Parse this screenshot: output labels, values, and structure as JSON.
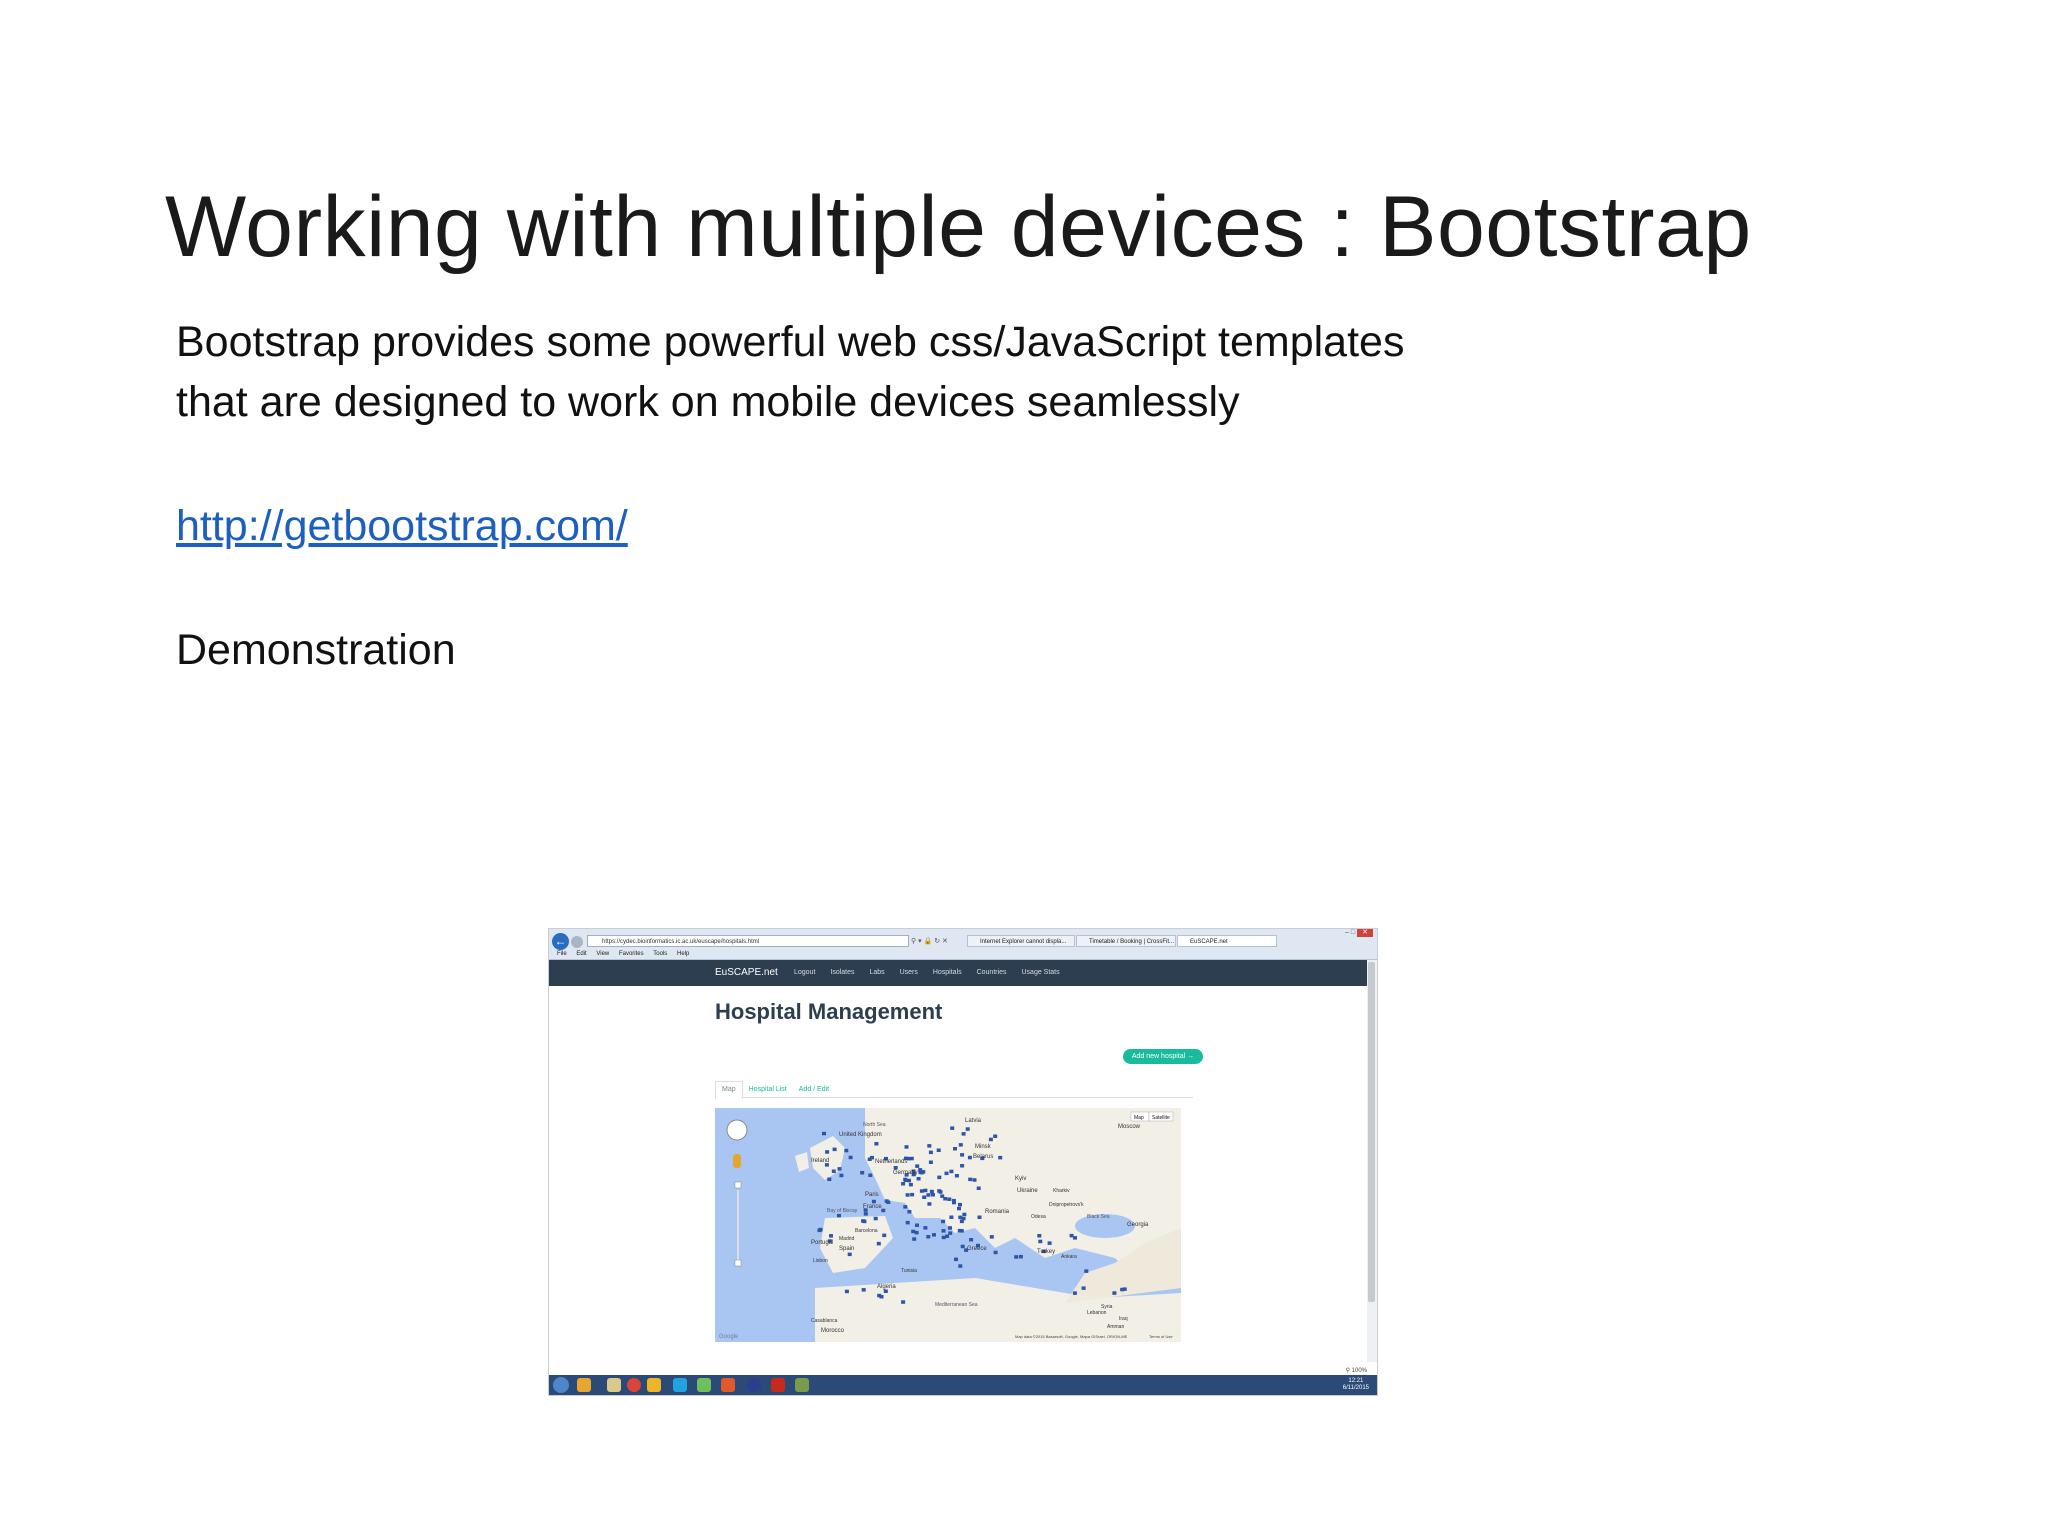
{
  "slide": {
    "title": "Working with multiple devices : Bootstrap",
    "body_line1": "Bootstrap provides some powerful web css/JavaScript templates",
    "body_line2": "that are designed to work on mobile devices seamlessly",
    "link": "http://getbootstrap.com/",
    "demo_label": "Demonstration"
  },
  "browser": {
    "url": "https://cydec.bioinformatics.ic.ac.uk/euscape/hospitals.html",
    "tabs": [
      "Internet Explorer cannot displa...",
      "Timetable / Booking | CrossFit...",
      "EuSCAPE.net"
    ],
    "menu": [
      "File",
      "Edit",
      "View",
      "Favorites",
      "Tools",
      "Help"
    ],
    "zoom": "100%"
  },
  "app": {
    "brand": "EuSCAPE.net",
    "nav": [
      "Logout",
      "Isolates",
      "Labs",
      "Users",
      "Hospitals",
      "Countries",
      "Usage Stats"
    ],
    "heading": "Hospital Management",
    "add_button": "Add new hospital →",
    "tabs": [
      "Map",
      "Hospital List",
      "Add / Edit"
    ]
  },
  "map": {
    "type_buttons": [
      "Map",
      "Satellite"
    ],
    "labels": [
      "Latvia",
      "Moscow",
      "United Kingdom",
      "Ireland",
      "Netherlands",
      "Germany",
      "Belarus",
      "Minsk",
      "Kyiv",
      "Ukraine",
      "Paris",
      "France",
      "Romania",
      "Bay of Biscay",
      "Portugal",
      "Spain",
      "Madrid",
      "Barcelona",
      "Greece",
      "Turkey",
      "Georgia",
      "Black Sea",
      "Algeria",
      "Tunisia",
      "Morocco",
      "Casablanca",
      "Lisbon",
      "Syria",
      "Iraq",
      "Lebanon",
      "Mediterranean Sea",
      "North Sea",
      "Kharkiv",
      "Dnipropetrovs'k",
      "Odesa",
      "Ankara",
      "Amman"
    ],
    "attribution": "Map data ©2015 Basarsoft, Google, Mapa GISrael, ORION-ME",
    "terms": "Terms of Use",
    "google": "Google"
  },
  "taskbar": {
    "time": "12:21",
    "date": "6/11/2015"
  },
  "colors": {
    "navbar": "#2c3e50",
    "accent": "#18bc9c",
    "link": "#1c5fbf",
    "marker": "#2f55a8",
    "map_water": "#a9c6f3",
    "map_land": "#f2efe6"
  }
}
